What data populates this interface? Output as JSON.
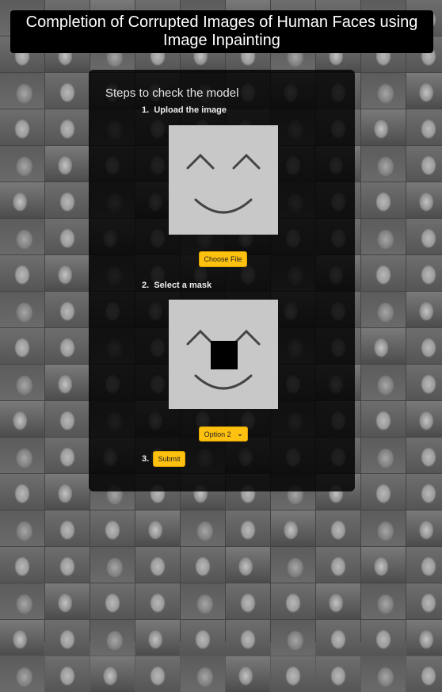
{
  "header": {
    "title": "Completion of Corrupted Images of Human Faces using Image Inpainting"
  },
  "panel": {
    "title": "Steps to check the model",
    "step1": {
      "number": "1.",
      "label": "Upload the image",
      "button": "Choose File"
    },
    "step2": {
      "number": "2.",
      "label": "Select a mask",
      "selected_option": "Option 2"
    },
    "step3": {
      "number": "3.",
      "button": "Submit"
    }
  },
  "colors": {
    "accent": "#fec10f",
    "panel": "#000000",
    "header": "#000000"
  }
}
